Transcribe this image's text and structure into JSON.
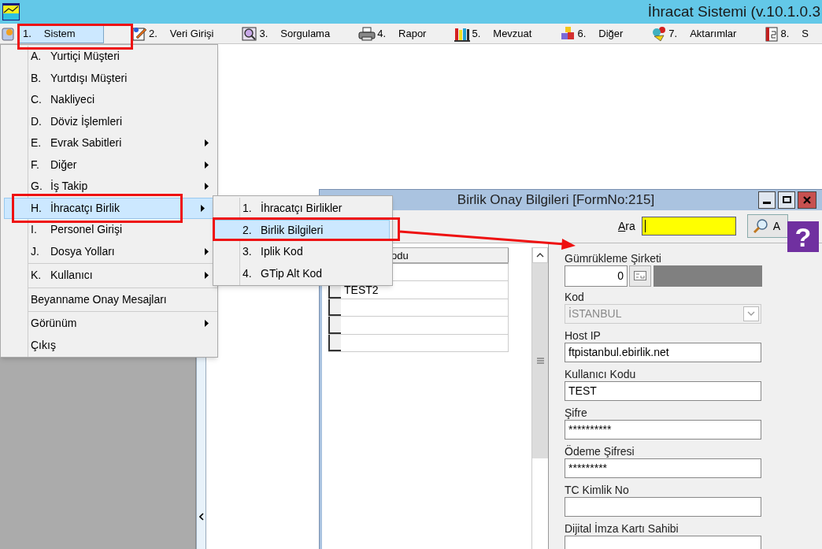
{
  "window": {
    "title": "İhracat Sistemi (v.10.1.0.3"
  },
  "menu_bar": [
    {
      "number": "1.",
      "label": "Sistem",
      "selected": true
    },
    {
      "number": "2.",
      "label": "Veri Girişi",
      "selected": false
    },
    {
      "number": "3.",
      "label": "Sorgulama",
      "selected": false
    },
    {
      "number": "4.",
      "label": "Rapor",
      "selected": false
    },
    {
      "number": "5.",
      "label": "Mevzuat",
      "selected": false
    },
    {
      "number": "6.",
      "label": "Diğer",
      "selected": false
    },
    {
      "number": "7.",
      "label": "Aktarımlar",
      "selected": false
    },
    {
      "number": "8.",
      "label": "S",
      "selected": false
    }
  ],
  "sistem_menu": [
    {
      "kind": "item",
      "key": "A.",
      "label": "Yurtiçi Müşteri",
      "submenu": false,
      "selected": false
    },
    {
      "kind": "item",
      "key": "B.",
      "label": "Yurtdışı Müşteri",
      "submenu": false,
      "selected": false
    },
    {
      "kind": "item",
      "key": "C.",
      "label": "Nakliyeci",
      "submenu": false,
      "selected": false
    },
    {
      "kind": "item",
      "key": "D.",
      "label": "Döviz İşlemleri",
      "submenu": false,
      "selected": false
    },
    {
      "kind": "item",
      "key": "E.",
      "label": "Evrak Sabitleri",
      "submenu": true,
      "selected": false
    },
    {
      "kind": "item",
      "key": "F.",
      "label": "Diğer",
      "submenu": true,
      "selected": false
    },
    {
      "kind": "item",
      "key": "G.",
      "label": "İş Takip",
      "submenu": true,
      "selected": false
    },
    {
      "kind": "item",
      "key": "H.",
      "label": "İhracatçı Birlik",
      "submenu": true,
      "selected": true
    },
    {
      "kind": "item",
      "key": "I.",
      "label": "Personel Girişi",
      "submenu": false,
      "selected": false
    },
    {
      "kind": "item",
      "key": "J.",
      "label": "Dosya Yolları",
      "submenu": true,
      "selected": false
    },
    {
      "kind": "separator"
    },
    {
      "kind": "item",
      "key": "K.",
      "label": "Kullanıcı",
      "submenu": true,
      "selected": false
    },
    {
      "kind": "separator"
    },
    {
      "kind": "item",
      "label": "Beyanname Onay Mesajları",
      "submenu": false,
      "selected": false
    },
    {
      "kind": "separator"
    },
    {
      "kind": "item",
      "label": "Görünüm",
      "submenu": true,
      "selected": false
    },
    {
      "kind": "item",
      "label": "Çıkış",
      "submenu": false,
      "selected": false
    }
  ],
  "birlik_submenu": [
    {
      "key": "1.",
      "label": "İhracatçı Birlikler",
      "selected": false
    },
    {
      "key": "2.",
      "label": "Birlik Bilgileri",
      "selected": true
    },
    {
      "key": "3.",
      "label": "Iplik Kod",
      "selected": false
    },
    {
      "key": "4.",
      "label": "GTip Alt Kod",
      "selected": false
    }
  ],
  "form_window": {
    "title": "Birlik Onay Bilgileri [FormNo:215]",
    "search": {
      "label": "Ara",
      "button": "A"
    },
    "help": "?",
    "grid": {
      "column": "odu",
      "rows": [
        {
          "code": "TEST2"
        }
      ]
    },
    "fields": [
      {
        "kind": "lookup",
        "label": "Gümrükleme Şirketi",
        "value": "0"
      },
      {
        "kind": "select",
        "label": "Kod",
        "value": "İSTANBUL",
        "disabled": true
      },
      {
        "kind": "text",
        "label": "Host IP",
        "value": "ftpistanbul.ebirlik.net"
      },
      {
        "kind": "text",
        "label": "Kullanıcı Kodu",
        "value": "TEST"
      },
      {
        "kind": "text",
        "label": "Şifre",
        "value": "**********"
      },
      {
        "kind": "text",
        "label": "Ödeme Şifresi",
        "value": "*********"
      },
      {
        "kind": "text",
        "label": "TC Kimlik No"
      },
      {
        "kind": "text",
        "label": "Dijital İmza Kartı Sahibi"
      }
    ]
  }
}
